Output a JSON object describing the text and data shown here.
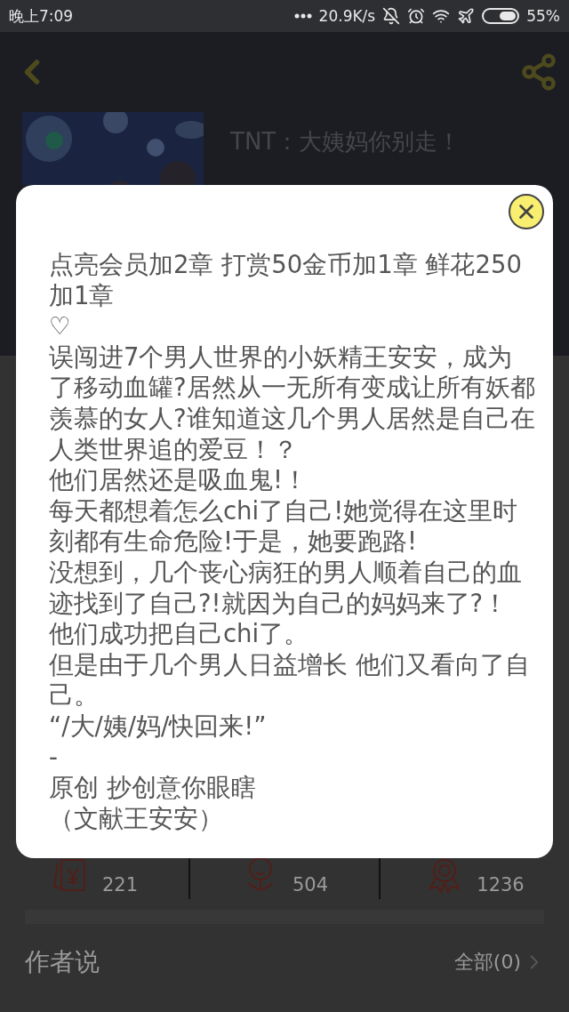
{
  "status_bar": {
    "time": "晚上7:09",
    "network_speed": "20.9K/s",
    "battery": "55%"
  },
  "book": {
    "title": "TNT：大姨妈你别走！"
  },
  "stats": [
    {
      "kind": "coins",
      "value": "221"
    },
    {
      "kind": "flower",
      "value": "504"
    },
    {
      "kind": "medal",
      "value": "1236"
    }
  ],
  "author_note": {
    "title": "作者说",
    "link": "全部(0)"
  },
  "dialog": {
    "paragraphs": [
      "点亮会员加2章 打赏50金币加1章 鲜花250加1章",
      "♡",
      "误闯进7个男人世界的小妖精王安安，成为了移动血罐?居然从一无所有变成让所有妖都羡慕的女人?谁知道这几个男人居然是自己在人类世界追的爱豆！？",
      "他们居然还是吸血鬼!！",
      "每天都想着怎么chi了自己!她觉得在这里时刻都有生命危险!于是，她要跑路!",
      "没想到，几个丧心病狂的男人顺着自己的血迹找到了自己?!就因为自己的妈妈来了?！",
      "他们成功把自己chi了。",
      "但是由于几个男人日益增长 他们又看向了自己。",
      "“/大/姨/妈/快回来!”",
      "-",
      "原创 抄创意你眼瞎",
      "（文献王安安）"
    ]
  }
}
